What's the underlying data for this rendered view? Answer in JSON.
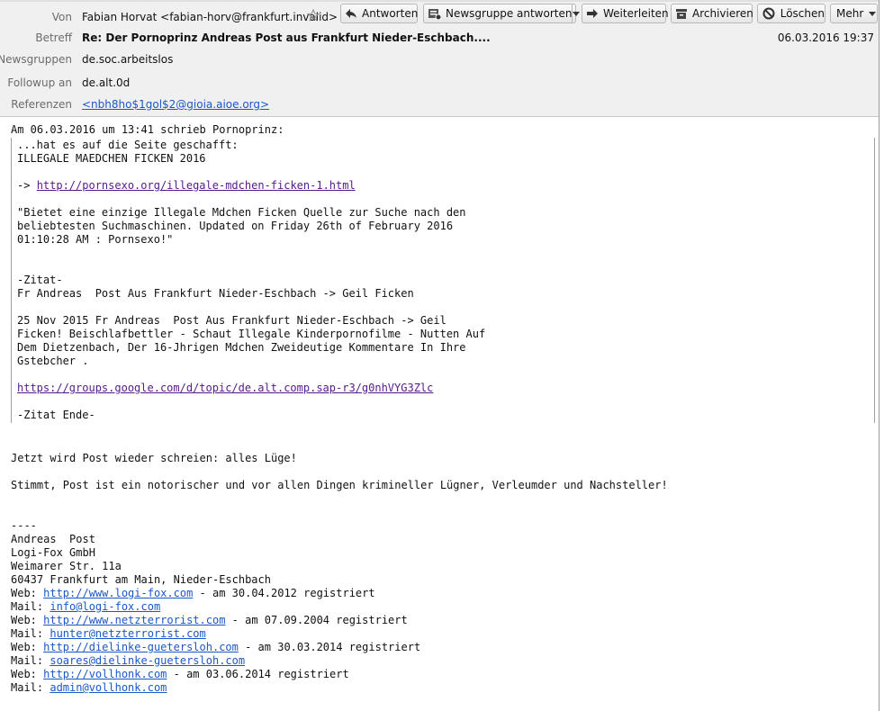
{
  "header": {
    "from_label": "Von",
    "from_value": "Fabian Horvat <fabian-horv@frankfurt.invalid>",
    "subject_label": "Betreff",
    "subject_value": "Re: Der Pornoprinz Andreas Post aus Frankfurt Nieder-Eschbach....",
    "newsgroups_label": "Newsgruppen",
    "newsgroups_value": "de.soc.arbeitslos",
    "followup_label": "Followup an",
    "followup_value": "de.alt.0d",
    "references_label": "Referenzen",
    "references_value": "<nbh8ho$1gol$2@gioia.aioe.org>",
    "date": "06.03.2016 19:37"
  },
  "toolbar": {
    "reply": "Antworten",
    "reply_newsgroup": "Newsgruppe antworten",
    "forward": "Weiterleiten",
    "archive": "Archivieren",
    "delete": "Löschen",
    "more": "Mehr"
  },
  "body": {
    "intro": "Am 06.03.2016 um 13:41 schrieb Pornoprinz:",
    "quote": {
      "l1": "...hat es auf die Seite geschafft:",
      "l2": "ILLEGALE MAEDCHEN FICKEN 2016",
      "l3_prefix": "-> ",
      "l3_link": "http://pornsexo.org/illegale-mdchen-ficken-1.html",
      "l4": "\"Bietet eine einzige Illegale Mdchen Ficken Quelle zur Suche nach den",
      "l5": "beliebtesten Suchmaschinen. Updated on Friday 26th of February 2016",
      "l6": "01:10:28 AM : Pornsexo!\"",
      "l7": "-Zitat-",
      "l8": "Fr Andreas  Post Aus Frankfurt Nieder-Eschbach -> Geil Ficken",
      "l9": "25 Nov 2015 Fr Andreas  Post Aus Frankfurt Nieder-Eschbach -> Geil",
      "l10": "Ficken! Beischlafbettler - Schaut Illegale Kinderpornofilme - Nutten Auf",
      "l11": "Dem Dietzenbach, Der 16-Jhrigen Mdchen Zweideutige Kommentare In Ihre",
      "l12": "Gstebcher .",
      "l13_link": "https://groups.google.com/d/topic/de.alt.comp.sap-r3/g0nhVYG3Zlc",
      "l14": "-Zitat Ende-"
    },
    "reply1": "Jetzt wird Post wieder schreien: alles Lüge!",
    "reply2": "Stimmt, Post ist ein notorischer und vor allen Dingen krimineller Lügner, Verleumder und Nachsteller!",
    "sig": {
      "sep": "----",
      "name": "Andreas  Post",
      "company": "Logi-Fox GmbH",
      "street": "Weimarer Str. 11a",
      "city": "60437 Frankfurt am Main, Nieder-Eschbach",
      "web_label": "Web: ",
      "mail_label": "Mail: ",
      "web1": "http://www.logi-fox.com",
      "web1_suffix": " - am 30.04.2012 registriert",
      "mail1": "info@logi-fox.com",
      "web2": "http://www.netzterrorist.com",
      "web2_suffix": " - am 07.09.2004 registriert",
      "mail2": "hunter@netzterrorist.com",
      "web3": "http://dielinke-guetersloh.com",
      "web3_suffix": " - am 30.03.2014 registriert",
      "mail3": "soares@dielinke-guetersloh.com",
      "web4": "http://vollhonk.com",
      "web4_suffix": " - am 03.06.2014 registriert",
      "mail4": "admin@vollhonk.com"
    }
  },
  "colors": {
    "link_visited": "#551a8b",
    "link": "#1a57c9",
    "header_bg": "#f0f0f0"
  }
}
